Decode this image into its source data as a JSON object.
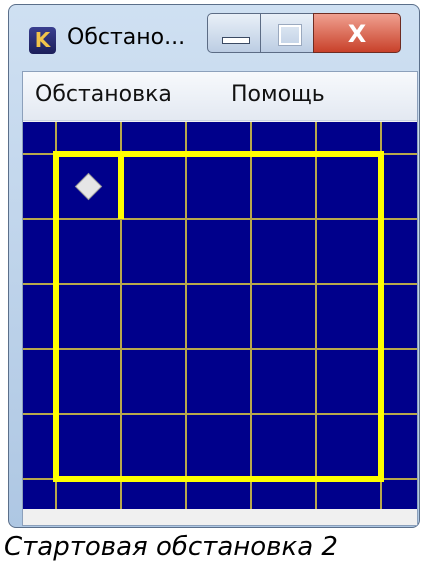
{
  "window": {
    "title": "Обстано...",
    "app_icon_letter": "K",
    "close_label": "X"
  },
  "menu": {
    "items": [
      "Обстановка",
      "Помощь"
    ]
  },
  "field": {
    "background": "#00008b",
    "grid_color": "#b8a84c",
    "wall_color": "#ffff00",
    "robot_color": "#e6e6e6",
    "robot_icon": "diamond-icon",
    "columns": 6,
    "rows": 6
  },
  "caption": "Стартовая обстановка 2"
}
